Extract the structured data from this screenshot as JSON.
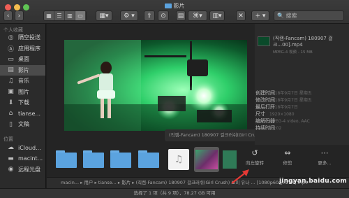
{
  "window": {
    "title": "影片"
  },
  "toolbar": {
    "back": "‹",
    "forward": "›",
    "action": "⚙ ▾",
    "share": "⇪",
    "tags": "⊙",
    "close": "✕",
    "add": "+ ▾",
    "search_placeholder": "🔍 搜索"
  },
  "sidebar": {
    "favorites_header": "个人收藏",
    "items": [
      {
        "label": "隔空投送",
        "icon": "◎"
      },
      {
        "label": "应用程序",
        "icon": "Ⓐ"
      },
      {
        "label": "桌面",
        "icon": "▭"
      },
      {
        "label": "影片",
        "icon": "▤"
      },
      {
        "label": "音乐",
        "icon": "♫"
      },
      {
        "label": "图片",
        "icon": "▣"
      },
      {
        "label": "下载",
        "icon": "⬇"
      },
      {
        "label": "tianse...",
        "icon": "⌂"
      },
      {
        "label": "文稿",
        "icon": "▯"
      }
    ],
    "locations_header": "位置",
    "locations": [
      {
        "label": "iCloud...",
        "icon": "☁"
      },
      {
        "label": "macint...",
        "icon": "▬"
      },
      {
        "label": "远程光盘",
        "icon": "◉"
      }
    ]
  },
  "preview": {
    "filename": "(직캠-Fancam) 180907 걸크러쉬(Girl Crush) 보미 ... .mp4"
  },
  "inspector": {
    "title": "(직캠-Fancam) 180907 걸크...00].mp4",
    "subtitle": "MPEG-4 视频 - 15 MB",
    "rows": [
      {
        "label": "创建时间",
        "value": "2018年9月7日 星期五"
      },
      {
        "label": "修改时间",
        "value": "2018年9月7日 星期五"
      },
      {
        "label": "最后打开",
        "value": "2018年9月7日"
      },
      {
        "label": "尺寸",
        "value": "1920×1080"
      },
      {
        "label": "编解码器",
        "value": "MPEG-4 video, AAC"
      },
      {
        "label": "持续时间",
        "value": "01:02"
      }
    ]
  },
  "actions": [
    {
      "label": "向左旋转",
      "icon": "↺"
    },
    {
      "label": "修剪",
      "icon": "⇔"
    },
    {
      "label": "更多...",
      "icon": "⋯"
    }
  ],
  "pathbar": {
    "text": "macin... ▸ 用户 ▸ tianse... ▸ 影片 ▸ (직캠-Fancam) 180907 걸크러쉬(Girl Crush) 보미 유나 ... [1080p60@x264].mp4"
  },
  "statusbar": {
    "text": "选择了 1 项（共 9 项），78.27 GB 可用"
  },
  "watermark": {
    "text": "jingyan.baidu.com"
  },
  "colors": {
    "folder": "#5ba3df",
    "accent_arrow": "#e53935"
  }
}
